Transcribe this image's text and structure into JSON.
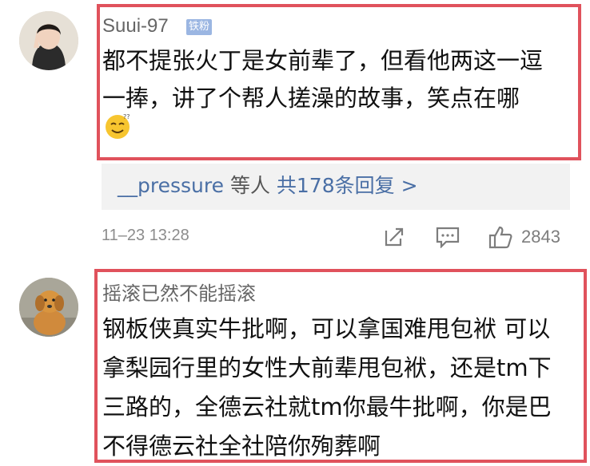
{
  "comments": [
    {
      "username": "Suui-97",
      "badge": "铁粉",
      "lines": [
        "都不提张火丁是女前辈了，但看他两这一逗",
        "一捧，讲了个帮人搓澡的故事，笑点在哪"
      ],
      "emoji": "confused-smile-emoji",
      "replies": {
        "user": "__pressure",
        "mid": "等人",
        "count": "共178条回复 >"
      },
      "time": "11–23 13:28",
      "likes": "2843"
    },
    {
      "username": "摇滚已然不能摇滚",
      "lines": [
        "钢板侠真实牛批啊，可以拿国难甩包袱 可以",
        "拿梨园行里的女性大前辈甩包袱，还是tm下",
        "三路的，全德云社就tm你最牛批啊，你是巴",
        "不得德云社全社陪你殉葬啊"
      ]
    }
  ],
  "colors": {
    "highlight": "#e0525c",
    "link": "#4a6fa5",
    "badge": "#9bb6e2"
  }
}
